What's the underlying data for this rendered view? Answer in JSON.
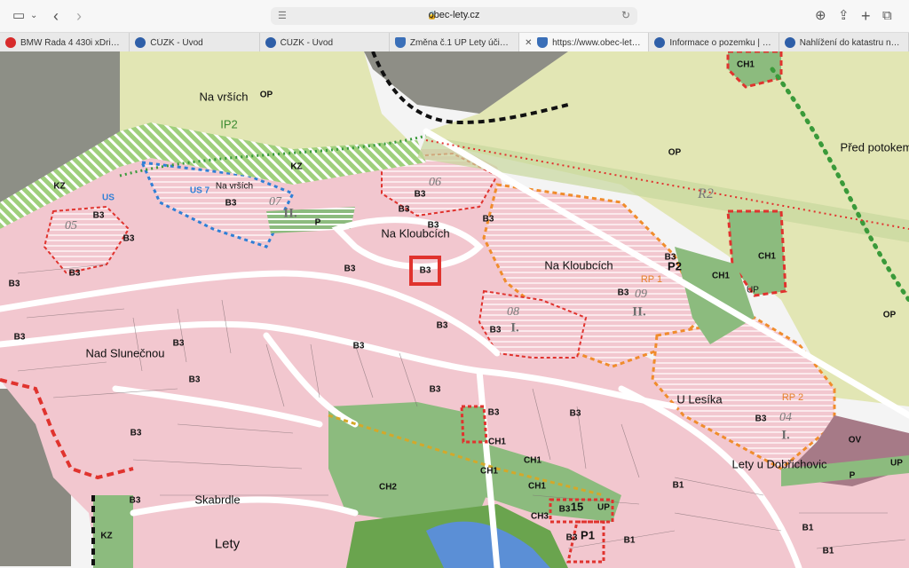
{
  "browser": {
    "url": "obec-lety.cz",
    "tabs": [
      {
        "label": "BMW Řada 4 430i xDrive Gr...",
        "icon": "bmw-icon"
      },
      {
        "label": "ČÚZK - Úvod",
        "icon": "cuzk-icon"
      },
      {
        "label": "ČÚZK - Úvod",
        "icon": "cuzk-icon"
      },
      {
        "label": "Změna č.1 ÚP Lety účinná o...",
        "icon": "shield-icon"
      },
      {
        "label": "https://www.obec-lety.cz/e...",
        "icon": "shield-icon",
        "active": true
      },
      {
        "label": "Informace o pozemku | Nahl...",
        "icon": "cuzk-icon"
      },
      {
        "label": "Nahlížení do katastru nemo...",
        "icon": "cuzk-icon"
      }
    ]
  },
  "map": {
    "labels": {
      "na_vrsich_1": "Na vrších",
      "op_1": "OP",
      "ip2": "IP2",
      "kz_1": "KZ",
      "kz_2": "KZ",
      "kz_3": "KZ",
      "na_vrsich_2": "Na vrších",
      "us7": "US 7",
      "us": "US",
      "num07": "07",
      "roman_ii_1": "II.",
      "p_1": "P",
      "num06": "06",
      "na_kloubcich_1": "Na Kloubcích",
      "na_kloubcich_2": "Na Kloubcích",
      "b3_highlight": "B3",
      "ch1_top": "CH1",
      "op_2": "OP",
      "pred_potokem": "Před potokem",
      "r2": "R2",
      "ch1_right": "CH1",
      "p2": "P2",
      "rp1": "RP 1",
      "num09": "09",
      "roman_ii_2": "II.",
      "ch1_mid": "CH1",
      "up_1": "UP",
      "op_3": "OP",
      "nad_slunecnou": "Nad Slunečnou",
      "num08": "08",
      "roman_i_1": "I.",
      "u_lesika": "U Lesíka",
      "rp2": "RP 2",
      "num04": "04",
      "roman_i_2": "I.",
      "ov": "OV",
      "up_2": "UP",
      "lety_u_dobrichovic": "Lety u Dobřichovic",
      "p_2": "P",
      "num05": "05",
      "skabrde": "Skabrdle",
      "lety": "Lety",
      "p1": "P1",
      "p15": "15",
      "up_3": "UP",
      "ch1_a": "CH1",
      "ch1_b": "CH1",
      "ch1_c": "CH1",
      "ch1_d": "CH1",
      "ch2": "CH2",
      "ch3": "CH3",
      "b1_a": "B1",
      "b1_b": "B1",
      "b1_c": "B1",
      "b1_d": "B1",
      "b3_list": [
        "B3",
        "B3",
        "B3",
        "B3",
        "B3",
        "B3",
        "B3",
        "B3",
        "B3",
        "B3",
        "B3",
        "B3",
        "B3",
        "B3",
        "B3",
        "B3",
        "B3",
        "B3",
        "B3",
        "B3",
        "B3",
        "B3",
        "B3",
        "B3",
        "B3",
        "B3"
      ]
    }
  },
  "colors": {
    "built_pink": "#f2c7cf",
    "meadow": "#e2e6b4",
    "green_zone": "#8cbb7e",
    "plum": "#a67a87",
    "red_border": "#e0332e",
    "orange": "#f08c2c"
  }
}
